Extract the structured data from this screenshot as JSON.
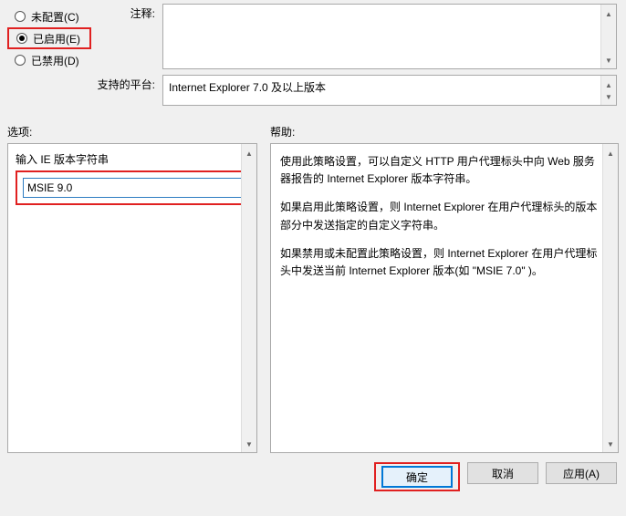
{
  "radios": {
    "not_configured": "未配置(C)",
    "enabled": "已启用(E)",
    "disabled": "已禁用(D)"
  },
  "labels": {
    "comment": "注释:",
    "platform": "支持的平台:",
    "options": "选项:",
    "help": "帮助:",
    "input_caption": "输入 IE 版本字符串"
  },
  "platform_text": "Internet Explorer 7.0 及以上版本",
  "option_value": "MSIE 9.0",
  "help_paragraphs": [
    "使用此策略设置，可以自定义 HTTP 用户代理标头中向 Web 服务器报告的 Internet Explorer 版本字符串。",
    "如果启用此策略设置，则 Internet Explorer 在用户代理标头的版本部分中发送指定的自定义字符串。",
    "如果禁用或未配置此策略设置，则 Internet Explorer 在用户代理标头中发送当前 Internet Explorer 版本(如 \"MSIE 7.0\" )。"
  ],
  "buttons": {
    "ok": "确定",
    "cancel": "取消",
    "apply": "应用(A)"
  }
}
